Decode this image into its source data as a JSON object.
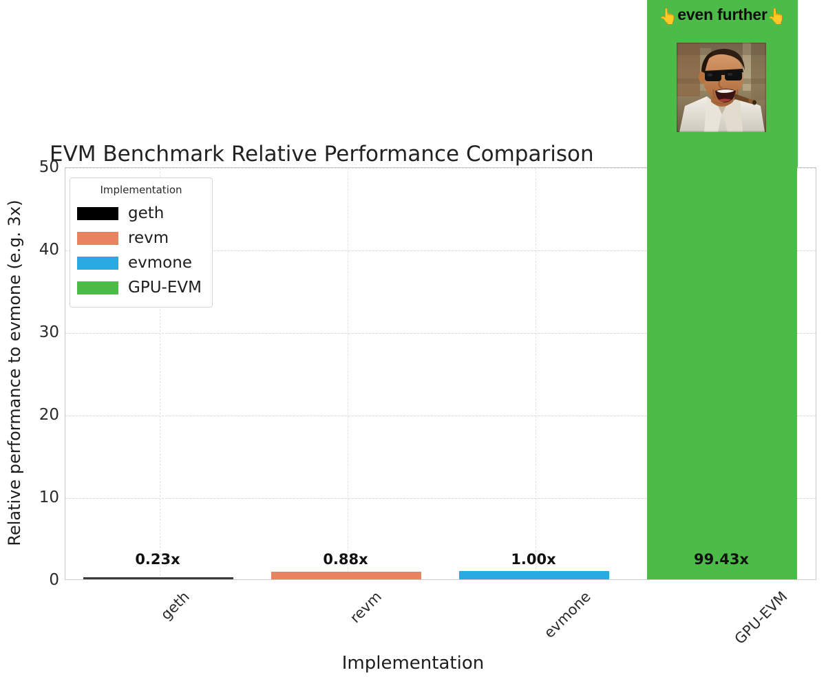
{
  "chart_data": {
    "type": "bar",
    "title": "EVM Benchmark Relative Performance Comparison",
    "xlabel": "Implementation",
    "ylabel": "Relative performance to evmone (e.g. 3x)",
    "categories": [
      "geth",
      "revm",
      "evmone",
      "GPU-EVM"
    ],
    "values": [
      0.23,
      0.88,
      1.0,
      99.43
    ],
    "value_labels": [
      "0.23x",
      "0.88x",
      "1.00x",
      "99.43x"
    ],
    "colors": [
      "#000000",
      "#E8825F",
      "#29ABE2",
      "#4CBB47"
    ],
    "ylim": [
      0,
      50
    ],
    "yticks": [
      "0",
      "10",
      "20",
      "30",
      "40",
      "50"
    ],
    "ytick_values": [
      0,
      10,
      20,
      30,
      40,
      50
    ],
    "grid": true,
    "legend": {
      "title": "Implementation",
      "position": "upper-left",
      "entries": [
        {
          "label": "geth",
          "color": "#000000"
        },
        {
          "label": "revm",
          "color": "#E8825F"
        },
        {
          "label": "evmone",
          "color": "#29ABE2"
        },
        {
          "label": "GPU-EVM",
          "color": "#4CBB47"
        }
      ]
    },
    "annotation": {
      "caption_text": "even further",
      "caption_left_emoji": "👆",
      "caption_right_emoji": "👆",
      "background_color": "#4CBB47",
      "image_description": "laughing-man-with-sunglasses-meme"
    }
  }
}
